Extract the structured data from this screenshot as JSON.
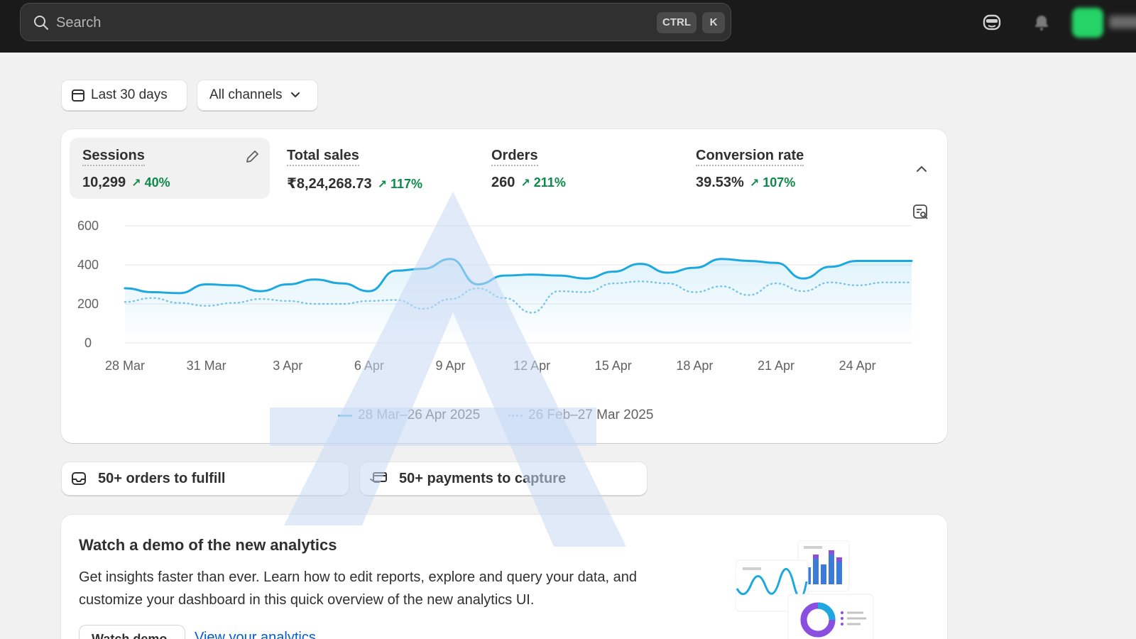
{
  "topbar": {
    "search_placeholder": "Search",
    "shortcut_ctrl": "CTRL",
    "shortcut_k": "K"
  },
  "filters": {
    "date_range": "Last 30 days",
    "channels": "All channels"
  },
  "metrics": [
    {
      "label": "Sessions",
      "value": "10,299",
      "delta": "40%"
    },
    {
      "label": "Total sales",
      "value": "₹8,24,268.73",
      "delta": "117%"
    },
    {
      "label": "Orders",
      "value": "260",
      "delta": "211%"
    },
    {
      "label": "Conversion rate",
      "value": "39.53%",
      "delta": "107%"
    }
  ],
  "chart_data": {
    "type": "line",
    "yticks": [
      "600",
      "400",
      "200",
      "0"
    ],
    "ylim": [
      0,
      600
    ],
    "categories": [
      "28 Mar",
      "31 Mar",
      "3 Apr",
      "6 Apr",
      "9 Apr",
      "12 Apr",
      "15 Apr",
      "18 Apr",
      "21 Apr",
      "24 Apr"
    ],
    "x": [
      "28 Mar",
      "29 Mar",
      "30 Mar",
      "31 Mar",
      "1 Apr",
      "2 Apr",
      "3 Apr",
      "4 Apr",
      "5 Apr",
      "6 Apr",
      "7 Apr",
      "8 Apr",
      "9 Apr",
      "10 Apr",
      "11 Apr",
      "12 Apr",
      "13 Apr",
      "14 Apr",
      "15 Apr",
      "16 Apr",
      "17 Apr",
      "18 Apr",
      "19 Apr",
      "20 Apr",
      "21 Apr",
      "22 Apr",
      "23 Apr",
      "24 Apr",
      "25 Apr",
      "26 Apr"
    ],
    "series": [
      {
        "name": "28 Mar–26 Apr 2025",
        "style": "solid",
        "color": "#1da9e0",
        "values": [
          280,
          260,
          255,
          300,
          295,
          265,
          300,
          325,
          305,
          265,
          370,
          380,
          430,
          300,
          345,
          350,
          345,
          330,
          365,
          405,
          360,
          385,
          430,
          420,
          410,
          330,
          390,
          420,
          420,
          420
        ]
      },
      {
        "name": "26 Feb–27 Mar 2025",
        "style": "dotted",
        "color": "#7cc4ea",
        "values": [
          210,
          230,
          205,
          190,
          205,
          225,
          215,
          200,
          200,
          215,
          220,
          175,
          225,
          280,
          230,
          155,
          265,
          260,
          305,
          315,
          305,
          260,
          290,
          245,
          305,
          265,
          310,
          295,
          310,
          310
        ]
      }
    ],
    "grid": true
  },
  "tasks": [
    {
      "label": "50+ orders to fulfill",
      "icon": "inbox-icon"
    },
    {
      "label": "50+ payments to capture",
      "icon": "payment-icon"
    }
  ],
  "demo": {
    "title": "Watch a demo of the new analytics",
    "body": "Get insights faster than ever. Learn how to edit reports, explore and query your data, and customize your dashboard in this quick overview of the new analytics UI.",
    "button": "Watch demo",
    "link": "View your analytics"
  },
  "colors": {
    "topbar": "#1a1a1a",
    "positive": "#0c8a4a",
    "line": "#1da9e0",
    "link": "#005bd3"
  }
}
